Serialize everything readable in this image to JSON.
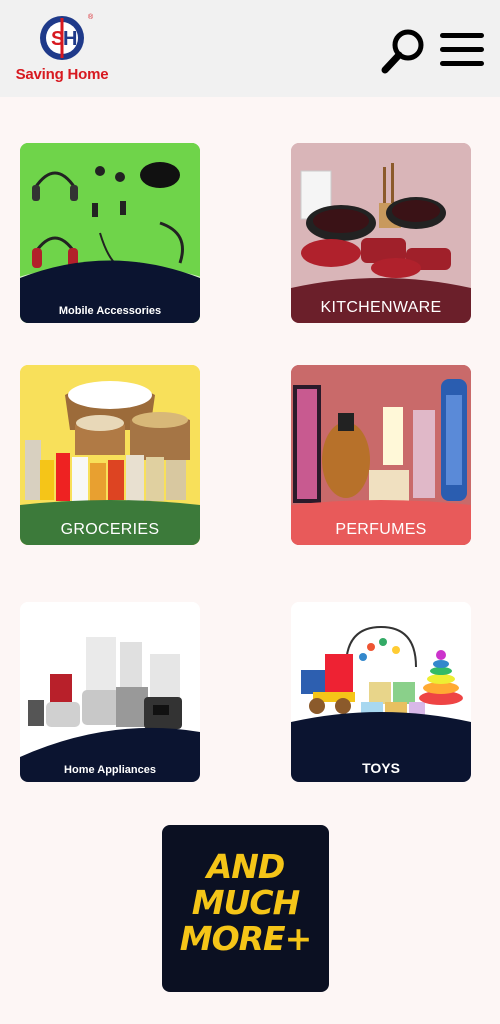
{
  "header": {
    "brand": "Saving Home",
    "logo_letters": "SH",
    "registered_mark": "®",
    "brand_color": "#d71920",
    "logo_blue": "#1f3a8a",
    "search_icon": "search-icon",
    "menu_icon": "hamburger-menu-icon"
  },
  "categories": [
    {
      "label": "Mobile Accessories",
      "bg": "#6fd44a",
      "band": "#0b1430"
    },
    {
      "label": "KITCHENWARE",
      "bg": "#d9b5b8",
      "band": "#6b1f2a"
    },
    {
      "label": "GROCERIES",
      "bg": "#f8e05a",
      "band": "#3c7a3a"
    },
    {
      "label": "PERFUMES",
      "bg": "#c96a6a",
      "band": "#e85a5a"
    },
    {
      "label": "Home Appliances",
      "bg": "#ffffff",
      "band": "#0b1430"
    },
    {
      "label": "TOYS",
      "bg": "#ffffff",
      "band": "#0b1430"
    }
  ],
  "more": {
    "label": "AND\nMUCH\nMORE+",
    "bg": "#0b1022",
    "text_color": "#f5c518"
  }
}
